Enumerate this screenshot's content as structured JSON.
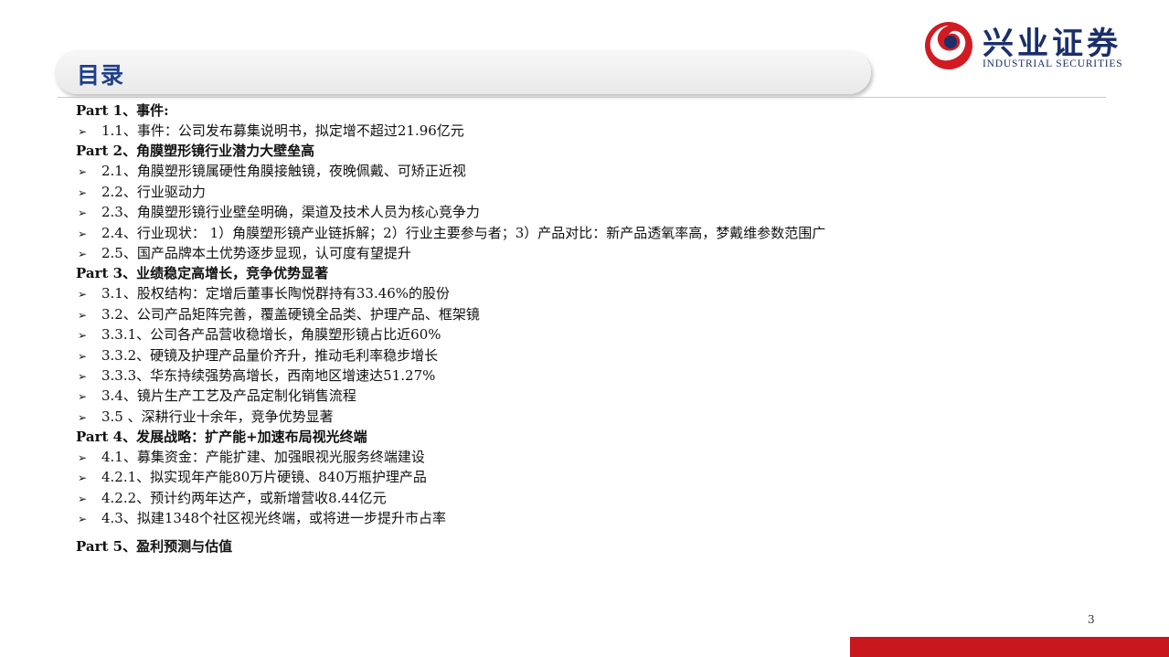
{
  "header": {
    "title": "目录",
    "logo_cn": "兴业证券",
    "logo_en": "INDUSTRIAL SECURITIES",
    "brand_red": "#d11a22",
    "brand_blue": "#1a2f6b"
  },
  "toc": {
    "part1": {
      "title": "Part 1、事件:",
      "items": [
        "1.1、事件：公司发布募集说明书，拟定增不超过21.96亿元"
      ]
    },
    "part2": {
      "title": "Part 2、角膜塑形镜行业潜力大壁垒高",
      "items": [
        "2.1、角膜塑形镜属硬性角膜接触镜，夜晚佩戴、可矫正近视",
        "2.2、行业驱动力",
        "2.3、角膜塑形镜行业壁垒明确，渠道及技术人员为核心竞争力",
        "2.4、行业现状： 1）角膜塑形镜产业链拆解；2）行业主要参与者；3）产品对比：新产品透氧率高，梦戴维参数范围广",
        "2.5、国产品牌本土优势逐步显现，认可度有望提升"
      ]
    },
    "part3": {
      "title": "Part 3、业绩稳定高增长，竞争优势显著",
      "items": [
        "3.1、股权结构：定增后董事长陶悦群持有33.46%的股份",
        "3.2、公司产品矩阵完善，覆盖硬镜全品类、护理产品、框架镜",
        "3.3.1、公司各产品营收稳增长，角膜塑形镜占比近60%",
        "3.3.2、硬镜及护理产品量价齐升，推动毛利率稳步增长",
        "3.3.3、华东持续强势高增长，西南地区增速达51.27%",
        "3.4、镜片生产工艺及产品定制化销售流程",
        "3.5 、深耕行业十余年，竞争优势显著"
      ]
    },
    "part4": {
      "title": "Part 4、发展战略：扩产能+加速布局视光终端",
      "items": [
        "4.1、募集资金：产能扩建、加强眼视光服务终端建设",
        "4.2.1、拟实现年产能80万片硬镜、840万瓶护理产品",
        "4.2.2、预计约两年达产，或新增营收8.44亿元",
        "4.3、拟建1348个社区视光终端，或将进一步提升市占率"
      ]
    },
    "part5": {
      "title": "Part 5、盈利预测与估值"
    }
  },
  "footer": {
    "page_number": "3"
  }
}
